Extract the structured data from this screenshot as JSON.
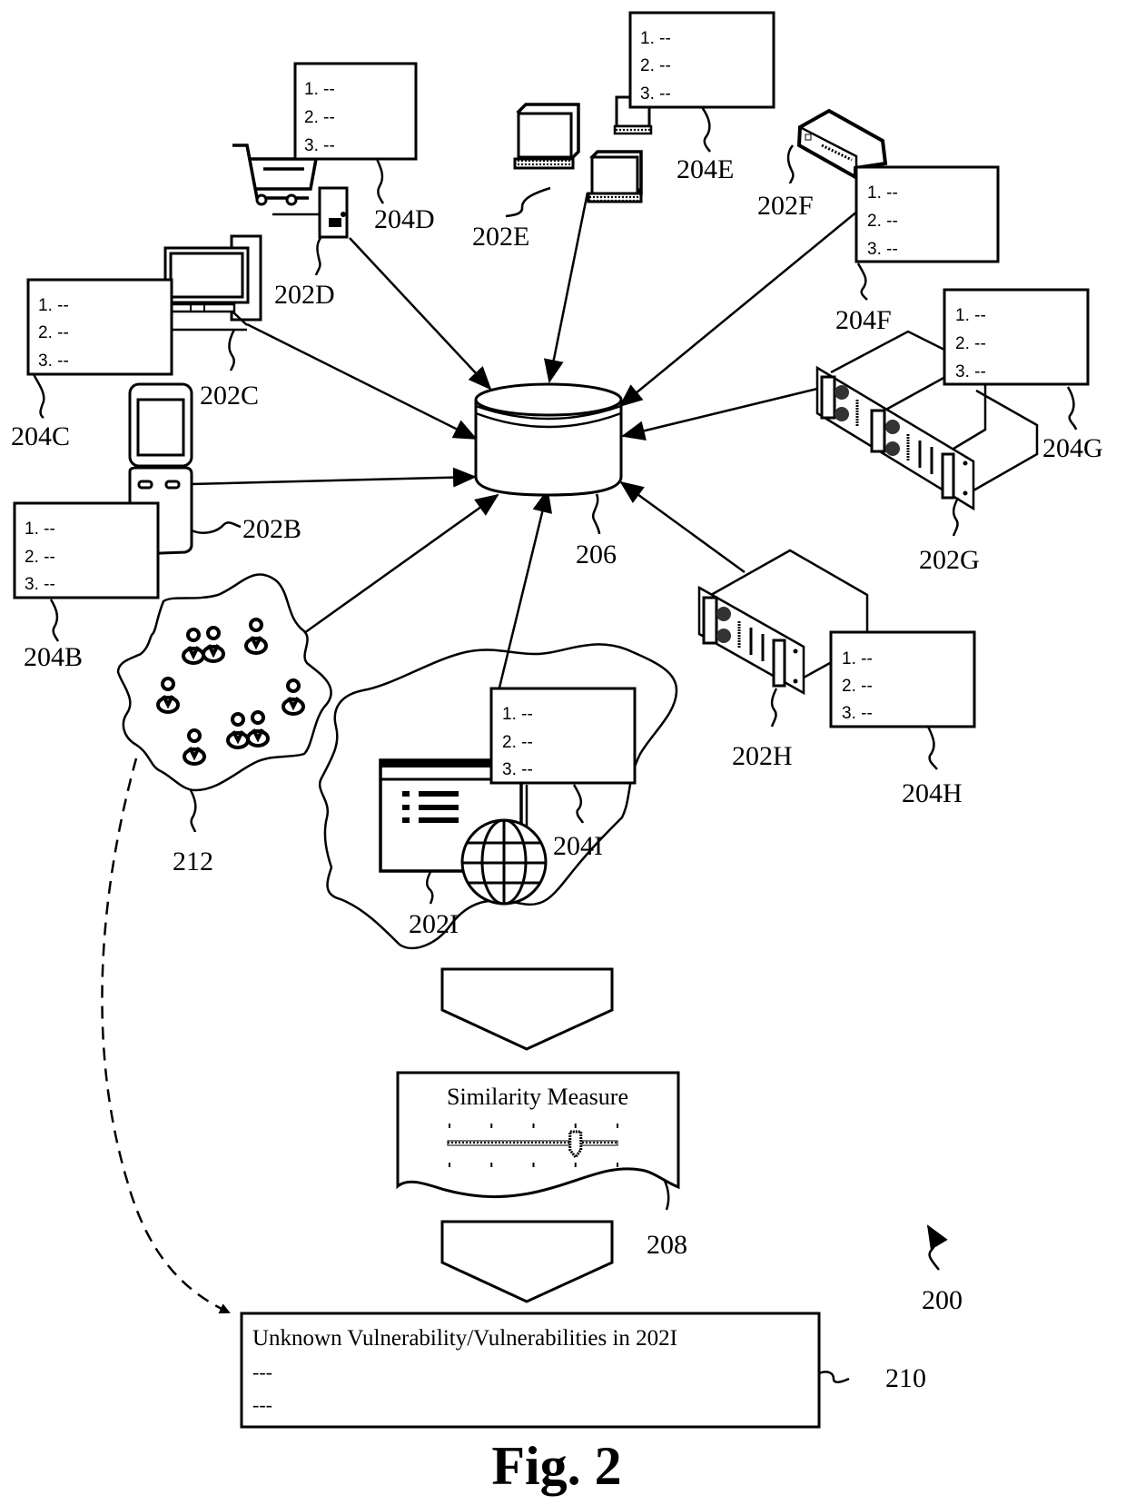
{
  "figure": {
    "caption": "Fig. 2",
    "overall_ref": "200",
    "database": {
      "ref": "206",
      "icon": "database-cylinder-icon"
    },
    "devices": [
      {
        "id": "202B",
        "icon": "mobile-phone-icon",
        "list_ref": "204B"
      },
      {
        "id": "202C",
        "icon": "desktop-computer-icon",
        "list_ref": "204C"
      },
      {
        "id": "202D",
        "icon": "shopping-cart-pos-terminal-icon",
        "list_ref": "204D"
      },
      {
        "id": "202E",
        "icon": "laptops-group-icon",
        "list_ref": "204E"
      },
      {
        "id": "202F",
        "icon": "network-switch-icon",
        "list_ref": "204F"
      },
      {
        "id": "202G",
        "icon": "rack-servers-icon",
        "list_ref": "204G"
      },
      {
        "id": "202H",
        "icon": "rack-server-icon",
        "list_ref": "204H"
      },
      {
        "id": "202I",
        "icon": "web-application-globe-icon",
        "list_ref": "204I"
      }
    ],
    "list_items": [
      "1. --",
      "2. --",
      "3. --"
    ],
    "community": {
      "ref": "212",
      "icon": "user-group-cloud-icon"
    },
    "similarity": {
      "ref": "208",
      "title": "Similarity Measure",
      "slider_value_fraction": 0.75,
      "tick_count": 5
    },
    "result": {
      "ref": "210",
      "title": "Unknown Vulnerability/Vulnerabilities in 202I",
      "lines": [
        "---",
        "---"
      ]
    }
  }
}
